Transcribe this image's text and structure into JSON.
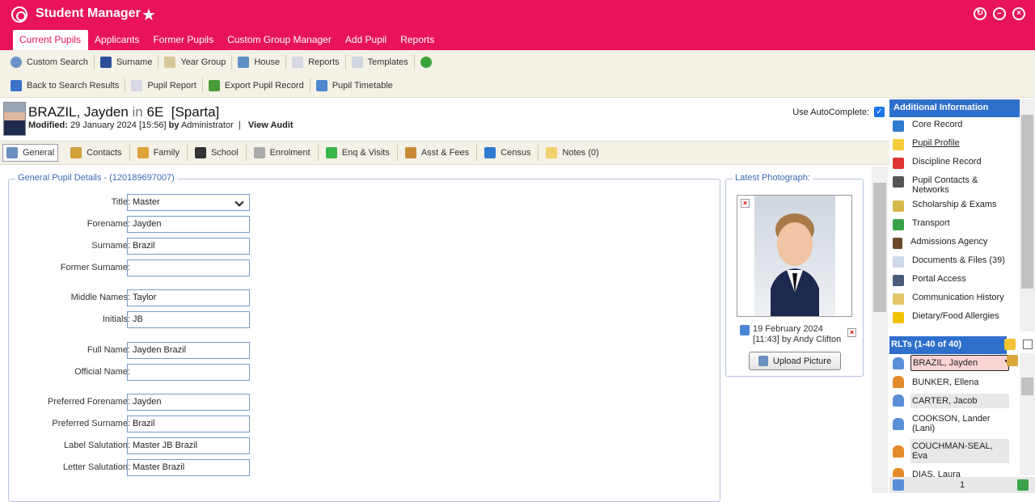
{
  "app": {
    "title": "Student Manager"
  },
  "nav_tabs": [
    "Current Pupils",
    "Applicants",
    "Former Pupils",
    "Custom Group Manager",
    "Add Pupil",
    "Reports"
  ],
  "toolbar1": [
    "Custom Search",
    "Surname",
    "Year Group",
    "House",
    "Reports",
    "Templates"
  ],
  "toolbar2": [
    "Back to Search Results",
    "Pupil Report",
    "Export Pupil Record",
    "Pupil Timetable"
  ],
  "pupil": {
    "name": "BRAZIL, Jayden",
    "in": "in",
    "form": "6E",
    "house": "[Sparta]",
    "modified_label": "Modified:",
    "modified": "29 January 2024 [15:56]",
    "by_label": "by",
    "by": "Administrator",
    "sep": "|",
    "view_audit": "View Audit",
    "autocomplete_label": "Use AutoComplete:"
  },
  "pupil_tabs": [
    "General",
    "Contacts",
    "Family",
    "School",
    "Enrolment",
    "Enq & Visits",
    "Asst & Fees",
    "Census",
    "Notes (0)"
  ],
  "general": {
    "legend": "General Pupil Details - (120189697007)",
    "fields": [
      {
        "label": "Title:",
        "value": "Master"
      },
      {
        "label": "Forename:",
        "value": "Jayden"
      },
      {
        "label": "Surname:",
        "value": "Brazil"
      },
      {
        "label": "Former Surname:",
        "value": ""
      },
      {
        "label": "Middle Names:",
        "value": "Taylor"
      },
      {
        "label": "Initials:",
        "value": "JB"
      },
      {
        "label": "Full Name:",
        "value": "Jayden Brazil"
      },
      {
        "label": "Official Name:",
        "value": ""
      },
      {
        "label": "Preferred Forename:",
        "value": "Jayden"
      },
      {
        "label": "Preferred Surname:",
        "value": "Brazil"
      },
      {
        "label": "Label Salutation:",
        "value": "Master JB Brazil"
      },
      {
        "label": "Letter Salutation:",
        "value": "Master Brazil"
      }
    ]
  },
  "photo": {
    "legend": "Latest Photograph:",
    "date": "19 February 2024",
    "by": "[11:43] by Andy Clifton",
    "upload_label": "Upload Picture"
  },
  "additional": {
    "title": "Additional Information",
    "items": [
      "Core Record",
      "Pupil Profile",
      "Discipline Record",
      "Pupil Contacts & Networks",
      "Scholarship & Exams",
      "Transport",
      "Admissions Agency",
      "Documents & Files (39)",
      "Portal Access",
      "Communication History",
      "Dietary/Food Allergies"
    ]
  },
  "rlts": {
    "title": "RLTs (1-40 of 40)",
    "items": [
      "BRAZIL, Jayden",
      "BUNKER, Ellena",
      "CARTER, Jacob",
      "COOKSON, Lander (Lani)",
      "COUCHMAN-SEAL, Eva",
      "DIAS, Laura"
    ],
    "page": "1"
  },
  "colors": {
    "brand": "#e8135c",
    "panel_header": "#2f6fcc"
  }
}
